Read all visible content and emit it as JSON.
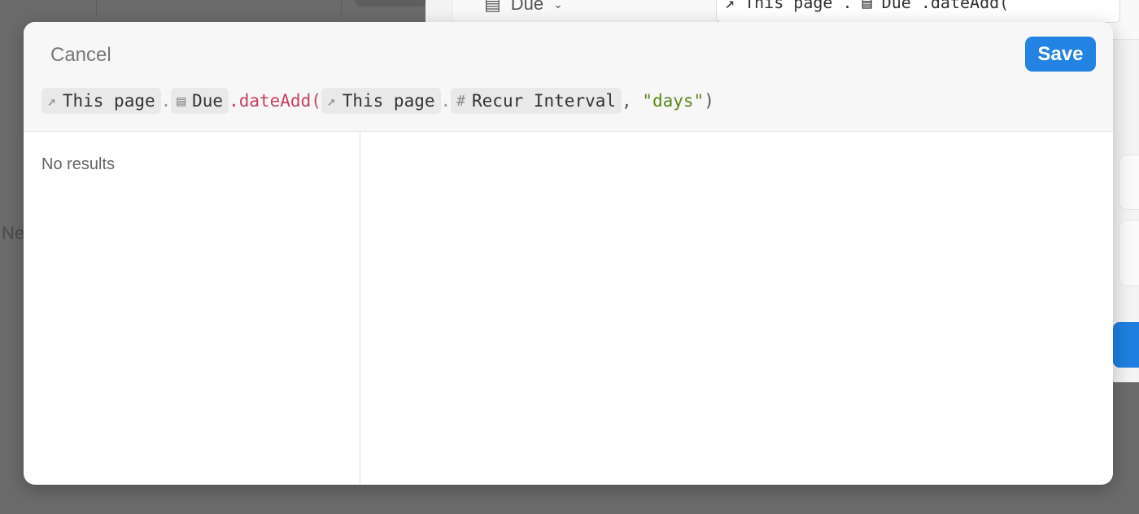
{
  "background": {
    "left_partial_text": "Ne",
    "property_label": "Due",
    "formula_preview": "↗ This page . ▤ Due .dateAdd("
  },
  "modal": {
    "cancel_label": "Cancel",
    "save_label": "Save",
    "formula": {
      "this_page_1": "This page",
      "due": "Due",
      "function": ".dateAdd(",
      "this_page_2": "This page",
      "recur_interval": "Recur Interval",
      "comma": ",",
      "string_arg": "\"days\"",
      "close_paren": ")",
      "dot": "."
    },
    "results": {
      "empty_text": "No results"
    }
  },
  "icons": {
    "page_link": "arrow-up-right-icon",
    "date": "calendar-icon",
    "number": "hash-icon"
  },
  "colors": {
    "accent": "#2383e2",
    "function": "#c94067",
    "string": "#5b8a1e"
  }
}
